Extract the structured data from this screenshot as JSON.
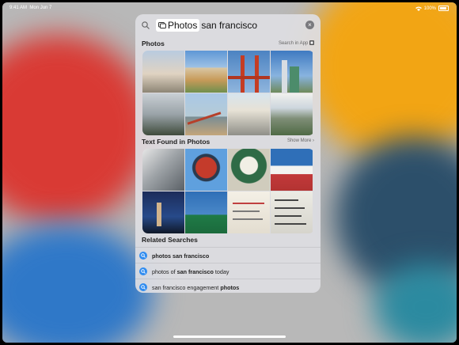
{
  "status_bar": {
    "time": "9:41 AM",
    "date": "Mon Jun 7",
    "battery": "100%"
  },
  "search": {
    "token": "Photos",
    "query": "san francisco",
    "search_icon": "magnifier-icon",
    "clear_icon": "clear-icon"
  },
  "photos_section": {
    "title": "Photos",
    "action": "Search in App"
  },
  "text_section": {
    "title": "Text Found in Photos",
    "action": "Show More"
  },
  "related": {
    "title": "Related Searches",
    "items": [
      {
        "pre": "",
        "bold": "photos san francisco",
        "post": ""
      },
      {
        "pre": "photos of ",
        "bold": "san francisco",
        "post": " today"
      },
      {
        "pre": "san francisco engagement ",
        "bold": "photos",
        "post": ""
      }
    ]
  },
  "colors": {
    "accent": "#2f8cf0",
    "panel": "#dedee2"
  }
}
